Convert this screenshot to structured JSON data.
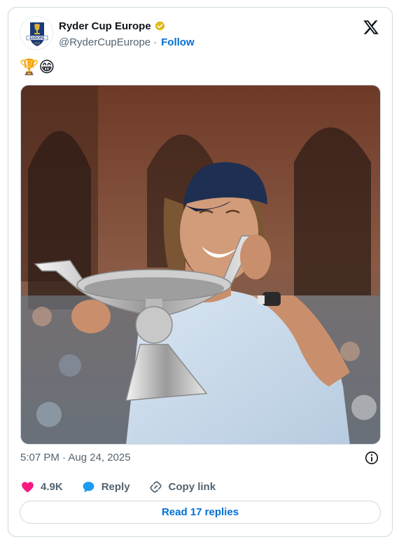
{
  "account": {
    "display_name": "Ryder Cup Europe",
    "handle": "@RyderCupEurope",
    "separator": "·",
    "follow_label": "Follow",
    "avatar_text": "EUROPE",
    "avatar_year": "2025"
  },
  "tweet": {
    "text": "🏆😁",
    "timestamp": "5:07 PM · Aug 24, 2025"
  },
  "actions": {
    "likes": "4.9K",
    "reply_label": "Reply",
    "copy_label": "Copy link"
  },
  "read_replies_label": "Read 17 replies",
  "colors": {
    "link": "#006fd6",
    "like": "#f91880",
    "reply": "#1d9bf0",
    "muted": "#536471",
    "border": "#cfd9de",
    "verified": "#e2b719"
  },
  "icons": [
    "verified-badge-icon",
    "x-logo-icon",
    "info-icon",
    "heart-icon",
    "reply-bubble-icon",
    "link-icon"
  ]
}
